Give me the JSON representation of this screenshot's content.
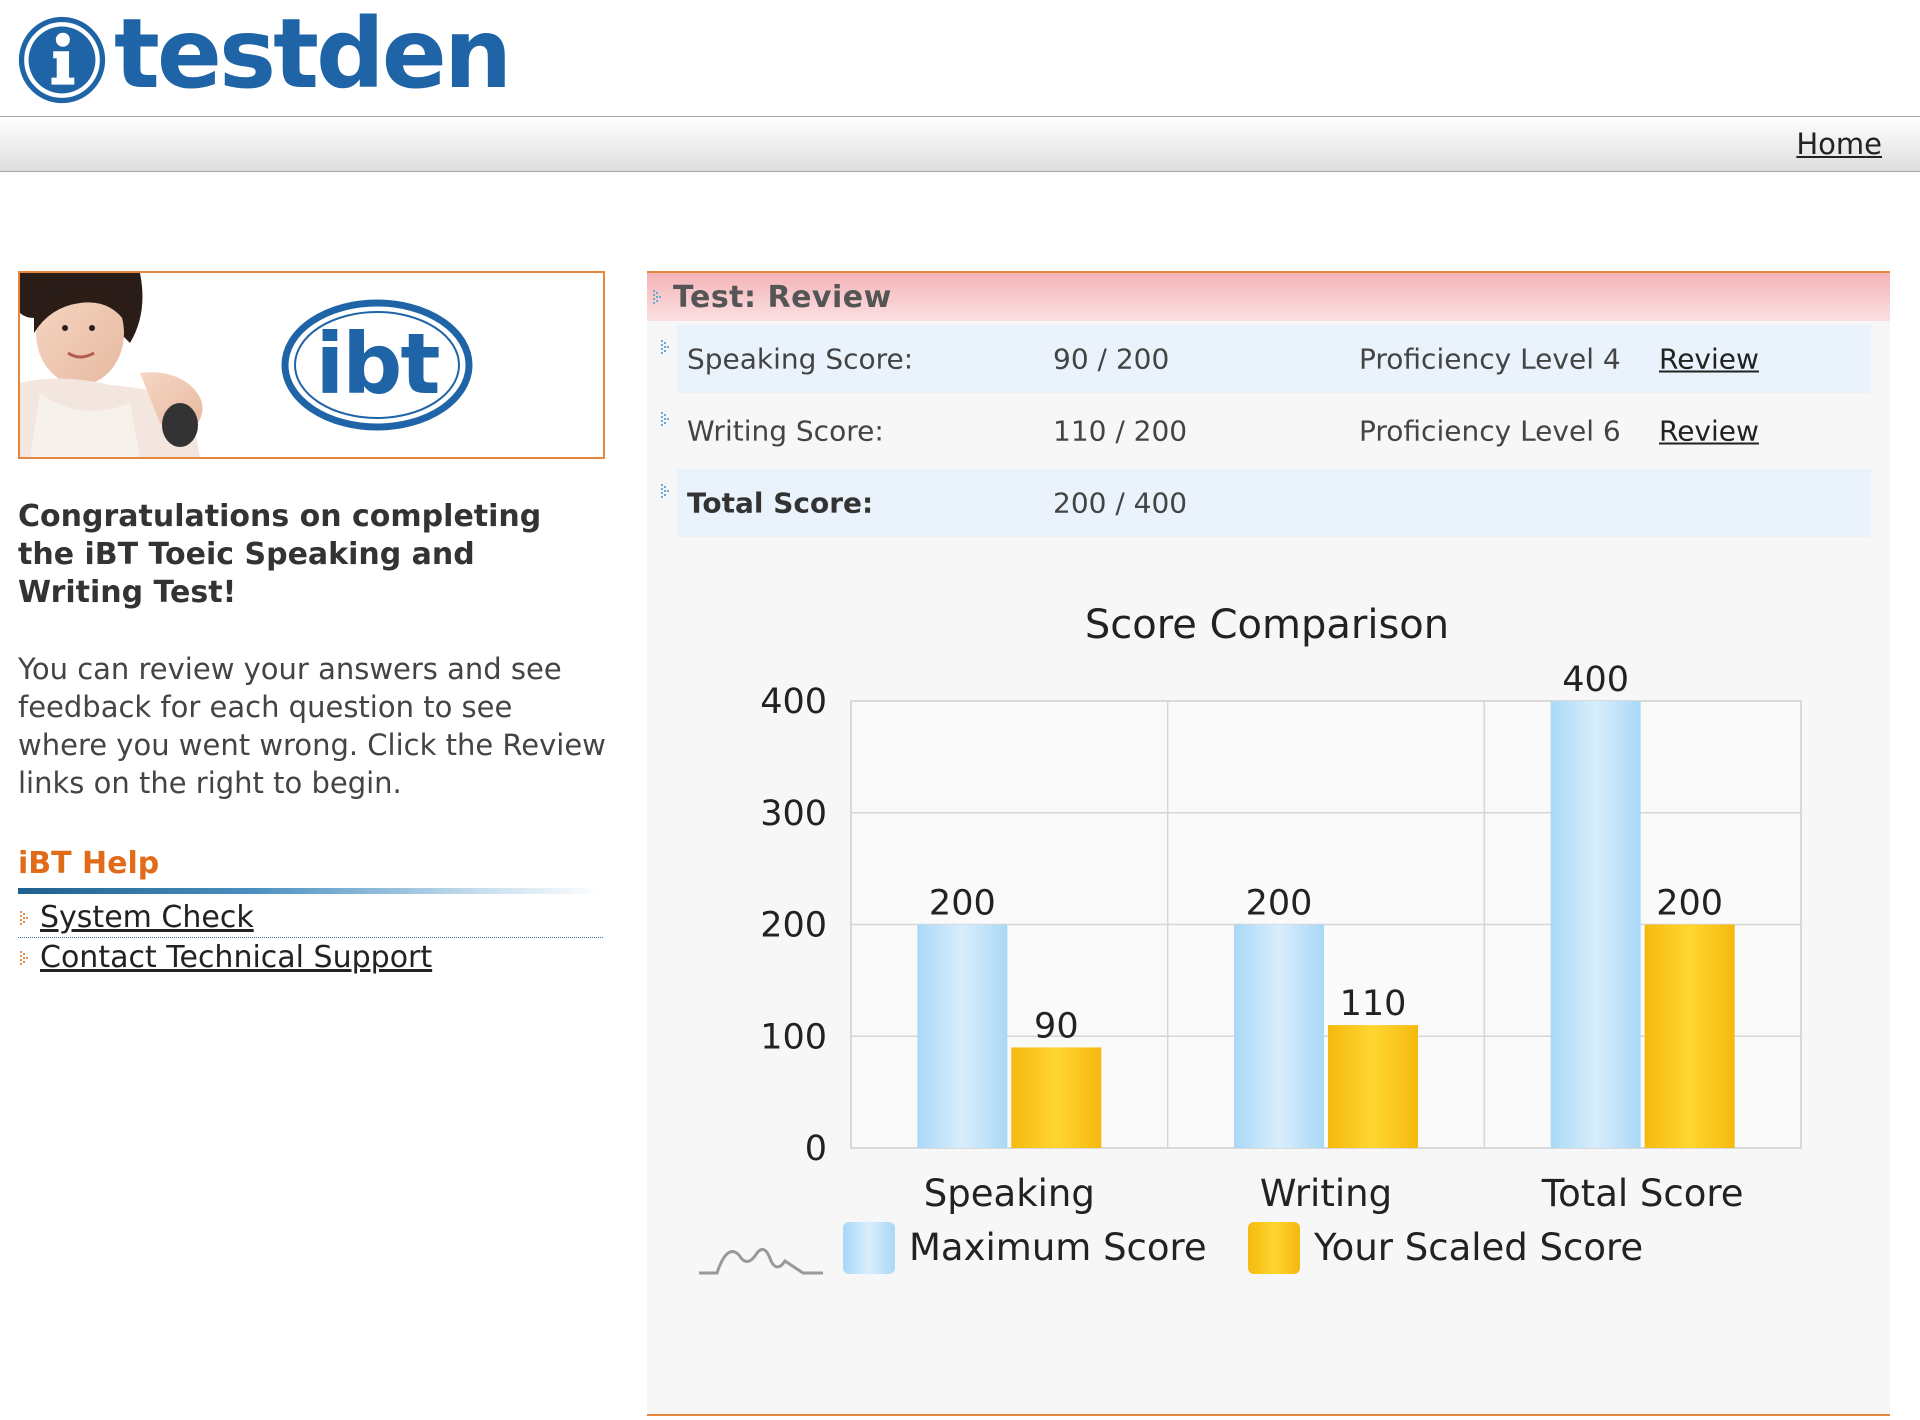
{
  "header": {
    "logo_text": "testden",
    "nav": {
      "home_label": "Home"
    }
  },
  "banner": {
    "logo_text": "ibt"
  },
  "left": {
    "congrats": "Congratulations on completing the iBT Toeic Speaking and Writing Test!",
    "intro": "You can review your answers and see feedback for each question to see where you went wrong. Click the Review links on the right to begin.",
    "help": {
      "title": "iBT Help",
      "links": [
        "System Check",
        "Contact Technical Support"
      ]
    }
  },
  "panel": {
    "title": "Test: Review",
    "rows": [
      {
        "label": "Speaking Score:",
        "value": "90 / 200",
        "level": "Proficiency Level 4",
        "review": "Review"
      },
      {
        "label": "Writing Score:",
        "value": "110 / 200",
        "level": "Proficiency Level 6",
        "review": "Review"
      },
      {
        "label": "Total Score:",
        "value": "200 / 400"
      }
    ]
  },
  "colors": {
    "accent_orange": "#e5883d",
    "brand_blue": "#1f64a6",
    "max_bar": "#bfe3fb",
    "score_bar": "#f8c51a"
  },
  "chart_data": {
    "type": "bar",
    "title": "Score Comparison",
    "categories": [
      "Speaking",
      "Writing",
      "Total Score"
    ],
    "series": [
      {
        "name": "Maximum Score",
        "values": [
          200,
          200,
          400
        ]
      },
      {
        "name": "Your Scaled Score",
        "values": [
          90,
          110,
          200
        ]
      }
    ],
    "ylim": [
      0,
      400
    ],
    "yticks": [
      0,
      100,
      200,
      300,
      400
    ],
    "grid": true,
    "legend": "bottom"
  }
}
